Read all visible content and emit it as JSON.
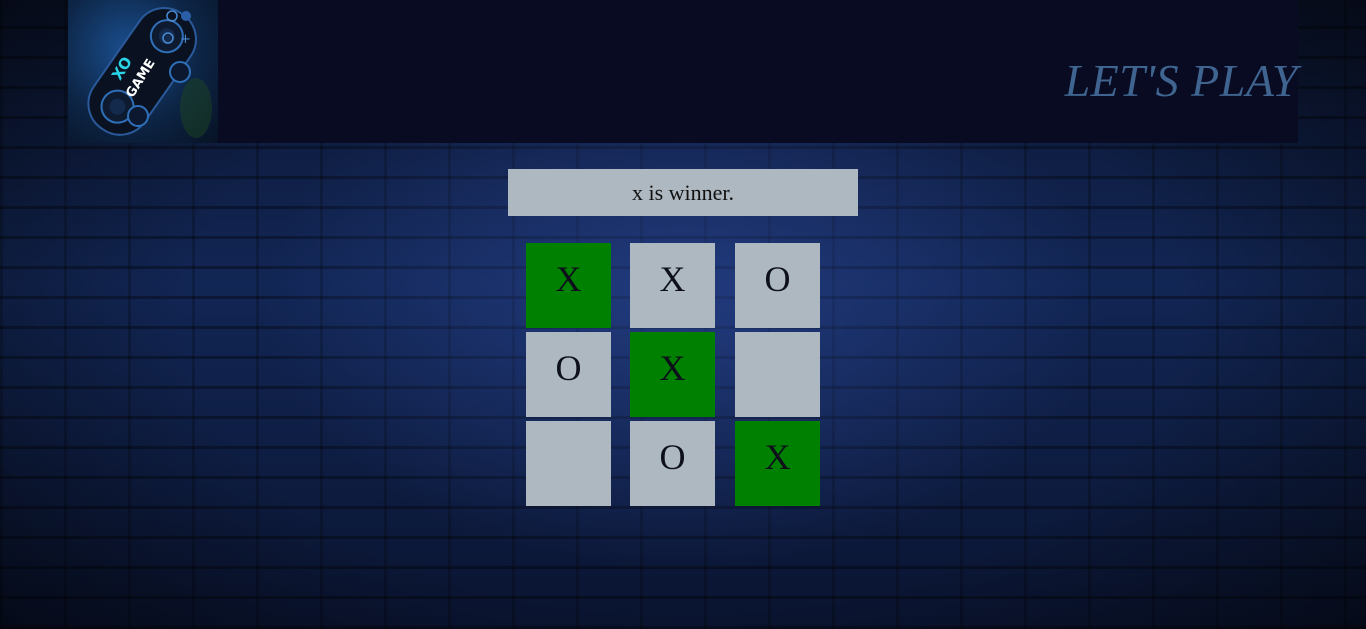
{
  "header": {
    "logo": {
      "text_top": "XO",
      "text_bottom": "GAME"
    },
    "title": "LET'S PLAY"
  },
  "game": {
    "status": "x is winner.",
    "win_color": "#008000",
    "cell_color": "#adb8c0",
    "cells": [
      {
        "mark": "X",
        "winning": true
      },
      {
        "mark": "X",
        "winning": false
      },
      {
        "mark": "O",
        "winning": false
      },
      {
        "mark": "O",
        "winning": false
      },
      {
        "mark": "X",
        "winning": true
      },
      {
        "mark": "",
        "winning": false
      },
      {
        "mark": "",
        "winning": false
      },
      {
        "mark": "O",
        "winning": false
      },
      {
        "mark": "X",
        "winning": true
      }
    ]
  }
}
